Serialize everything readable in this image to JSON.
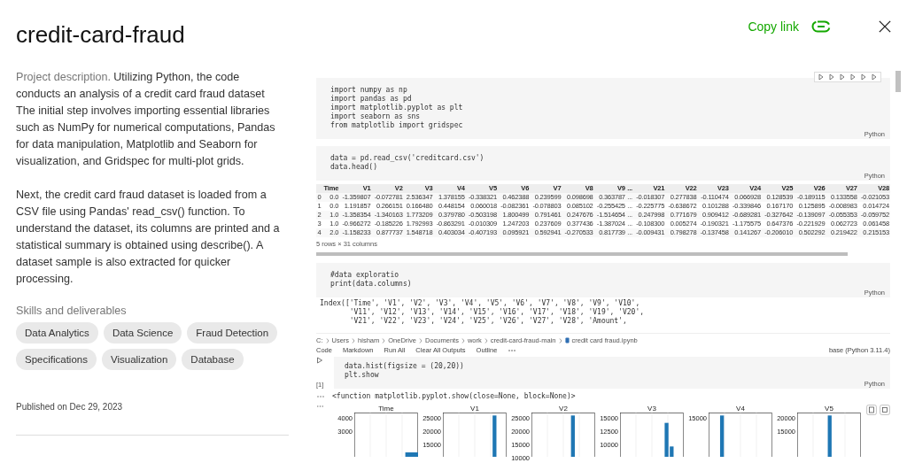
{
  "header": {
    "title": "credit-card-fraud",
    "copy_link": "Copy link"
  },
  "description": {
    "lead": "Project description.",
    "paragraphs": [
      "Utilizing Python, the code conducts an analysis of a credit card fraud dataset The initial step involves importing essential libraries such as NumPy for numerical computations, Pandas for data manipulation, Matplotlib and Seaborn for visualization, and Gridspec for multi-plot grids.",
      "Next, the credit card fraud dataset is loaded from a CSV file using Pandas' read_csv() function. To understand the dataset, its columns are printed and a statistical summary is obtained using describe(). A dataset sample is also extracted for quicker processing."
    ]
  },
  "skills": {
    "heading": "Skills and deliverables",
    "tags": [
      "Data Analytics",
      "Data Science",
      "Fraud Detection",
      "Specifications",
      "Visualization",
      "Database"
    ]
  },
  "published": "Published on Dec 29, 2023",
  "notebook": {
    "cells": [
      {
        "kind": "code",
        "toolbar": true,
        "language": "Python",
        "lines": [
          "import numpy as np",
          "import pandas as pd",
          "import matplotlib.pyplot as plt",
          "import seaborn as sns",
          "from matplotlib import gridspec"
        ]
      },
      {
        "kind": "code",
        "toolbar": false,
        "language": "Python",
        "lines": [
          "data = pd.read_csv('creditcard.csv')",
          "data.head()"
        ]
      },
      {
        "kind": "table",
        "caption": "5 rows × 31 columns",
        "columns": [
          "Time",
          "V1",
          "V2",
          "V3",
          "V4",
          "V5",
          "V6",
          "V7",
          "V8",
          "V9",
          "...",
          "V21",
          "V22",
          "V23",
          "V24",
          "V25",
          "V26",
          "V27",
          "V28"
        ],
        "rows": [
          {
            "index": "0",
            "cells": [
              "0.0",
              "-1.359807",
              "-0.072781",
              "2.536347",
              "1.378155",
              "-0.338321",
              "0.462388",
              "0.239599",
              "0.098698",
              "0.363787",
              "...",
              "-0.018307",
              "0.277838",
              "-0.110474",
              "0.066928",
              "0.128539",
              "-0.189115",
              "0.133558",
              "-0.021053"
            ]
          },
          {
            "index": "1",
            "cells": [
              "0.0",
              "1.191857",
              "0.266151",
              "0.166480",
              "0.448154",
              "0.060018",
              "-0.082361",
              "-0.078803",
              "0.085102",
              "-0.255425",
              "...",
              "-0.225775",
              "-0.638672",
              "0.101288",
              "-0.339846",
              "0.167170",
              "0.125895",
              "-0.008983",
              "0.014724"
            ]
          },
          {
            "index": "2",
            "cells": [
              "1.0",
              "-1.358354",
              "-1.340163",
              "1.773209",
              "0.379780",
              "-0.503198",
              "1.800499",
              "0.791461",
              "0.247676",
              "-1.514654",
              "...",
              "0.247998",
              "0.771679",
              "0.909412",
              "-0.689281",
              "-0.327642",
              "-0.139097",
              "-0.055353",
              "-0.059752"
            ]
          },
          {
            "index": "3",
            "cells": [
              "1.0",
              "-0.966272",
              "-0.185226",
              "1.792993",
              "-0.863291",
              "-0.010309",
              "1.247203",
              "0.237609",
              "0.377436",
              "-1.387024",
              "...",
              "-0.108300",
              "0.005274",
              "-0.190321",
              "-1.175575",
              "0.647376",
              "-0.221929",
              "0.062723",
              "0.061458"
            ]
          },
          {
            "index": "4",
            "cells": [
              "2.0",
              "-1.158233",
              "0.877737",
              "1.548718",
              "0.403034",
              "-0.407193",
              "0.095921",
              "0.592941",
              "-0.270533",
              "0.817739",
              "...",
              "-0.009431",
              "0.798278",
              "-0.137458",
              "0.141267",
              "-0.206010",
              "0.502292",
              "0.219422",
              "0.215153"
            ]
          }
        ]
      },
      {
        "kind": "code",
        "toolbar": false,
        "language": "Python",
        "lines": [
          "#data exploratio",
          "print(data.columns)"
        ]
      },
      {
        "kind": "output",
        "lines": [
          "Index(['Time', 'V1', 'V2', 'V3', 'V4', 'V5', 'V6', 'V7', 'V8', 'V9', 'V10',",
          "       'V11', 'V12', 'V13', 'V14', 'V15', 'V16', 'V17', 'V18', 'V19', 'V20',",
          "       'V21', 'V22', 'V23', 'V24', 'V25', 'V26', 'V27', 'V28', 'Amount',"
        ]
      }
    ]
  },
  "editor": {
    "breadcrumb": [
      "C:",
      "Users",
      "hisham",
      "OneDrive",
      "Documents",
      "work",
      "credit-card-fraud-main",
      "credit card fraud.ipynb"
    ],
    "toolbar": [
      "Code",
      "Markdown",
      "Run All",
      "Clear All Outputs",
      "Outline"
    ],
    "kernel": "base (Python 3.11.4)",
    "cell": {
      "exec": "[1]",
      "language": "Python",
      "lines": [
        "data.hist(figsize = (20,20))",
        "plt.show"
      ]
    },
    "output": "<function matplotlib.pyplot.show(close=None, block=None)>",
    "plots": [
      {
        "title": "Time",
        "yticks": [
          "4000",
          "3000"
        ]
      },
      {
        "title": "V1",
        "yticks": [
          "25000",
          "20000",
          "15000"
        ]
      },
      {
        "title": "V2",
        "yticks": [
          "25000",
          "20000",
          "15000",
          "10000"
        ]
      },
      {
        "title": "V3",
        "yticks": [
          "15000",
          "12500",
          "10000"
        ]
      },
      {
        "title": "V4",
        "yticks": [
          "15000"
        ]
      },
      {
        "title": "V5",
        "yticks": [
          "20000",
          "15000"
        ]
      }
    ]
  }
}
